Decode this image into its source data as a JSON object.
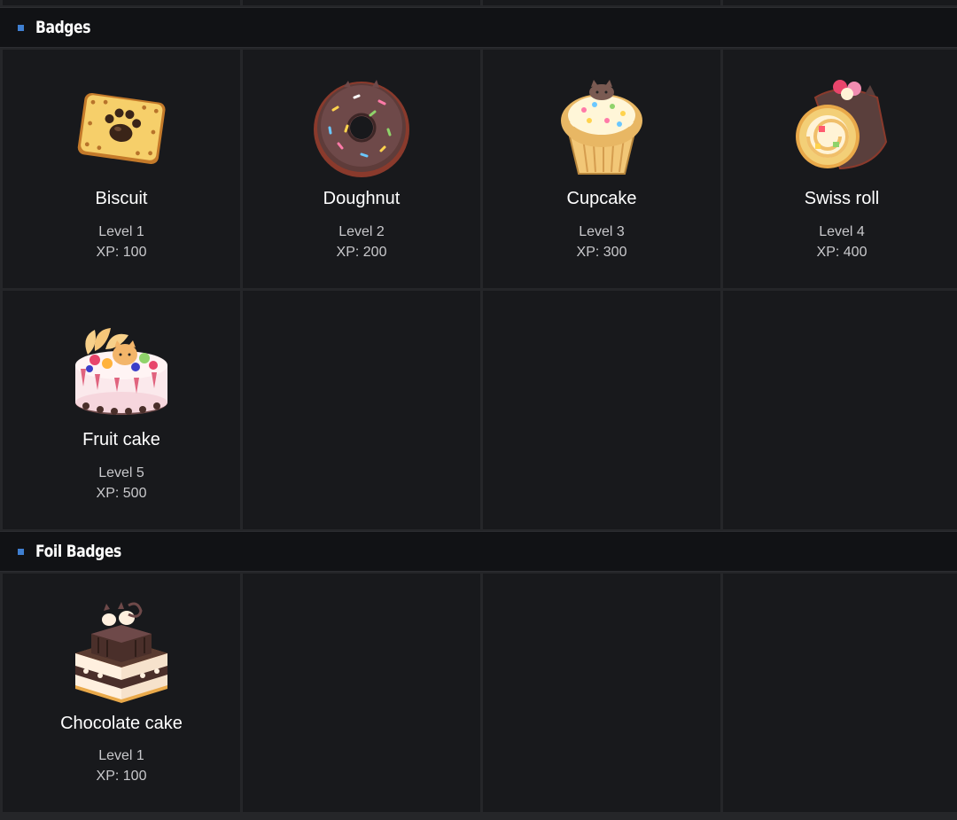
{
  "sections": [
    {
      "title": "Badges",
      "badges": [
        {
          "icon": "biscuit-icon",
          "name": "Biscuit",
          "level": "Level 1",
          "xp": "XP: 100"
        },
        {
          "icon": "doughnut-icon",
          "name": "Doughnut",
          "level": "Level 2",
          "xp": "XP: 200"
        },
        {
          "icon": "cupcake-icon",
          "name": "Cupcake",
          "level": "Level 3",
          "xp": "XP: 300"
        },
        {
          "icon": "swiss-roll-icon",
          "name": "Swiss roll",
          "level": "Level 4",
          "xp": "XP: 400"
        },
        {
          "icon": "fruit-cake-icon",
          "name": "Fruit cake",
          "level": "Level 5",
          "xp": "XP: 500"
        }
      ]
    },
    {
      "title": "Foil Badges",
      "badges": [
        {
          "icon": "chocolate-cake-icon",
          "name": "Chocolate cake",
          "level": "Level 1",
          "xp": "XP: 100"
        }
      ]
    }
  ],
  "colors": {
    "accent": "#3f7fd1",
    "cell_background": "#18191c",
    "header_background": "#111215"
  }
}
